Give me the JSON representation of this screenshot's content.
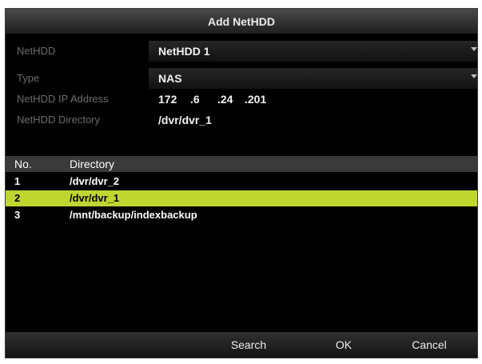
{
  "dialog": {
    "title": "Add NetHDD"
  },
  "form": {
    "nethdd": {
      "label": "NetHDD",
      "value": "NetHDD 1"
    },
    "type": {
      "label": "Type",
      "value": "NAS"
    },
    "ip": {
      "label": "NetHDD IP Address",
      "octets": [
        "172",
        ".6",
        ".24",
        ".201"
      ]
    },
    "directory": {
      "label": "NetHDD Directory",
      "value": "/dvr/dvr_1"
    }
  },
  "table": {
    "headers": {
      "no": "No.",
      "directory": "Directory"
    },
    "rows": [
      {
        "no": "1",
        "directory": "/dvr/dvr_2",
        "selected": false
      },
      {
        "no": "2",
        "directory": "/dvr/dvr_1",
        "selected": true
      },
      {
        "no": "3",
        "directory": "/mnt/backup/indexbackup",
        "selected": false
      }
    ]
  },
  "buttons": {
    "search": "Search",
    "ok": "OK",
    "cancel": "Cancel"
  },
  "colors": {
    "selected_row": "#bfd630",
    "background": "#000000"
  }
}
